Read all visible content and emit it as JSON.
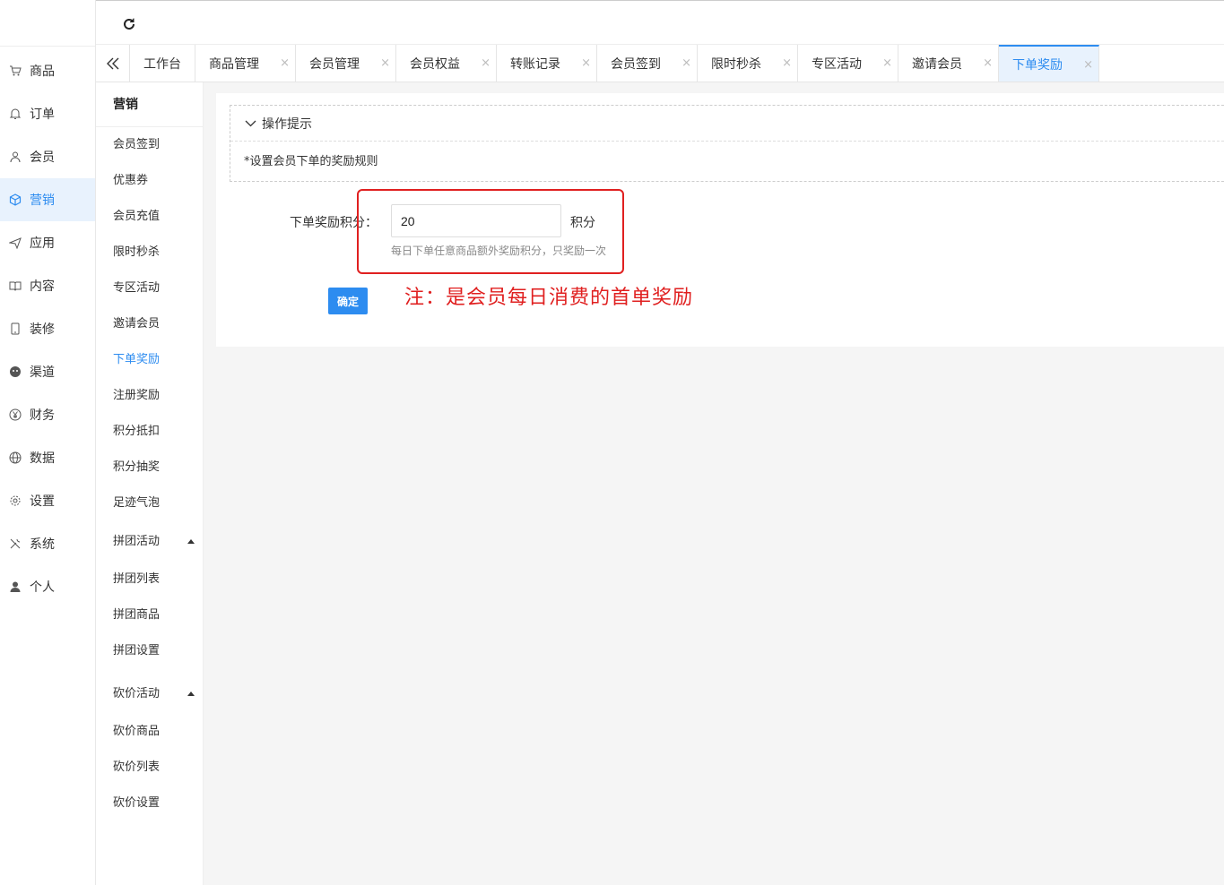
{
  "sidebar": {
    "items": [
      {
        "label": "商品",
        "icon": "cart-icon"
      },
      {
        "label": "订单",
        "icon": "bell-icon"
      },
      {
        "label": "会员",
        "icon": "user-icon"
      },
      {
        "label": "营销",
        "icon": "cube-icon",
        "active": true
      },
      {
        "label": "应用",
        "icon": "send-icon"
      },
      {
        "label": "内容",
        "icon": "book-icon"
      },
      {
        "label": "装修",
        "icon": "mobile-icon"
      },
      {
        "label": "渠道",
        "icon": "wechat-icon"
      },
      {
        "label": "财务",
        "icon": "yen-icon"
      },
      {
        "label": "数据",
        "icon": "globe-icon"
      },
      {
        "label": "设置",
        "icon": "gear-icon"
      },
      {
        "label": "系统",
        "icon": "tools-icon"
      },
      {
        "label": "个人",
        "icon": "person-icon"
      }
    ]
  },
  "tabs": [
    {
      "label": "工作台"
    },
    {
      "label": "商品管理"
    },
    {
      "label": "会员管理"
    },
    {
      "label": "会员权益"
    },
    {
      "label": "转账记录"
    },
    {
      "label": "会员签到"
    },
    {
      "label": "限时秒杀"
    },
    {
      "label": "专区活动"
    },
    {
      "label": "邀请会员"
    },
    {
      "label": "下单奖励",
      "active": true
    }
  ],
  "tab_close": "×",
  "submenu": {
    "title": "营销",
    "items": [
      {
        "label": "会员签到"
      },
      {
        "label": "优惠券"
      },
      {
        "label": "会员充值"
      },
      {
        "label": "限时秒杀"
      },
      {
        "label": "专区活动"
      },
      {
        "label": "邀请会员"
      },
      {
        "label": "下单奖励",
        "active": true
      },
      {
        "label": "注册奖励"
      },
      {
        "label": "积分抵扣"
      },
      {
        "label": "积分抽奖"
      },
      {
        "label": "足迹气泡"
      }
    ],
    "group1": {
      "label": "拼团活动",
      "children": [
        "拼团列表",
        "拼团商品",
        "拼团设置"
      ]
    },
    "group2": {
      "label": "砍价活动",
      "children": [
        "砍价商品",
        "砍价列表",
        "砍价设置"
      ]
    }
  },
  "tips": {
    "title": "操作提示",
    "body": "*设置会员下单的奖励规则"
  },
  "form": {
    "label": "下单奖励积分：",
    "value": "20",
    "unit": "积分",
    "help": "每日下单任意商品额外奖励积分，只奖励一次",
    "confirm": "确定"
  },
  "annotation": "注：是会员每日消费的首单奖励",
  "colors": {
    "accent": "#2d8cf0",
    "annotation": "#e02020"
  }
}
